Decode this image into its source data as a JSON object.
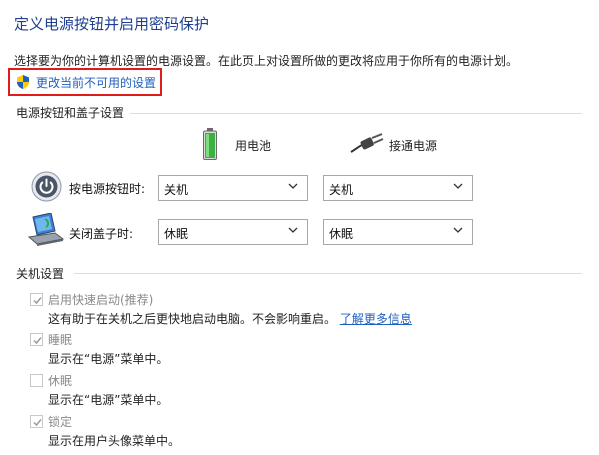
{
  "header": {
    "title": "定义电源按钮并启用密码保护",
    "description": "选择要为你的计算机设置的电源设置。在此页上对设置所做的更改将应用于你所有的电源计划。",
    "change_link": "更改当前不可用的设置"
  },
  "power_section": {
    "heading": "电源按钮和盖子设置",
    "col_battery": "用电池",
    "col_plugged": "接通电源",
    "rows": [
      {
        "label": "按电源按钮时:",
        "battery": "关机",
        "plugged": "关机",
        "icon": "power-button-icon"
      },
      {
        "label": "关闭盖子时:",
        "battery": "休眠",
        "plugged": "休眠",
        "icon": "laptop-lid-icon"
      }
    ]
  },
  "shutdown_section": {
    "heading": "关机设置",
    "items": [
      {
        "label": "启用快速启动(推荐)",
        "checked": true,
        "desc": "这有助于在关机之后更快地启动电脑。不会影响重启。",
        "link": "了解更多信息"
      },
      {
        "label": "睡眠",
        "checked": true,
        "desc": "显示在“电源”菜单中。"
      },
      {
        "label": "休眠",
        "checked": false,
        "desc": "显示在“电源”菜单中。"
      },
      {
        "label": "锁定",
        "checked": true,
        "desc": "显示在用户头像菜单中。"
      }
    ]
  },
  "colors": {
    "title": "#1e3f8f",
    "link": "#1f5fbf",
    "highlight_box": "#e01b1b",
    "battery": "#3cb043"
  }
}
